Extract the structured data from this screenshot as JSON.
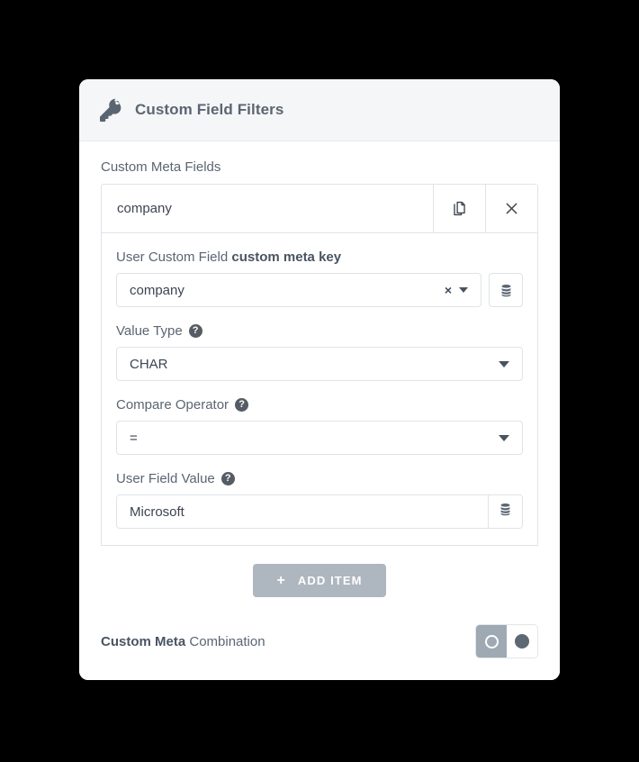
{
  "card": {
    "header": {
      "icon": "key-icon",
      "title": "Custom Field Filters"
    },
    "meta_fields_label": "Custom Meta Fields",
    "item": {
      "title": "company",
      "duplicate_icon": "copy-icon",
      "remove_icon": "close-icon",
      "fields": {
        "custom_field": {
          "label_prefix": "User Custom Field ",
          "label_strong": "custom meta key",
          "value": "company",
          "clear_glyph": "×",
          "db_icon": "database-icon"
        },
        "value_type": {
          "label": "Value Type",
          "help": "?",
          "value": "CHAR",
          "options": [
            "CHAR"
          ]
        },
        "compare_operator": {
          "label": "Compare Operator",
          "help": "?",
          "value": "=",
          "options": [
            "="
          ]
        },
        "user_field_value": {
          "label": "User Field Value",
          "help": "?",
          "value": "Microsoft",
          "placeholder": "",
          "db_icon": "database-icon"
        }
      }
    },
    "add_item": {
      "plus": "+",
      "label": "ADD ITEM"
    },
    "combination": {
      "label_strong": "Custom Meta",
      "label_rest": " Combination",
      "state": "on"
    }
  },
  "colors": {
    "page_bg": "#000000",
    "card_bg": "#ffffff",
    "header_bg": "#f5f6f7",
    "border": "#dfe3e8",
    "text": "#3d4451",
    "label": "#5b6572",
    "button_bg": "#aeb6bf",
    "toggle_on": "#9fa9b3",
    "toggle_dot": "#5d6873",
    "icon": "#5b6572"
  }
}
